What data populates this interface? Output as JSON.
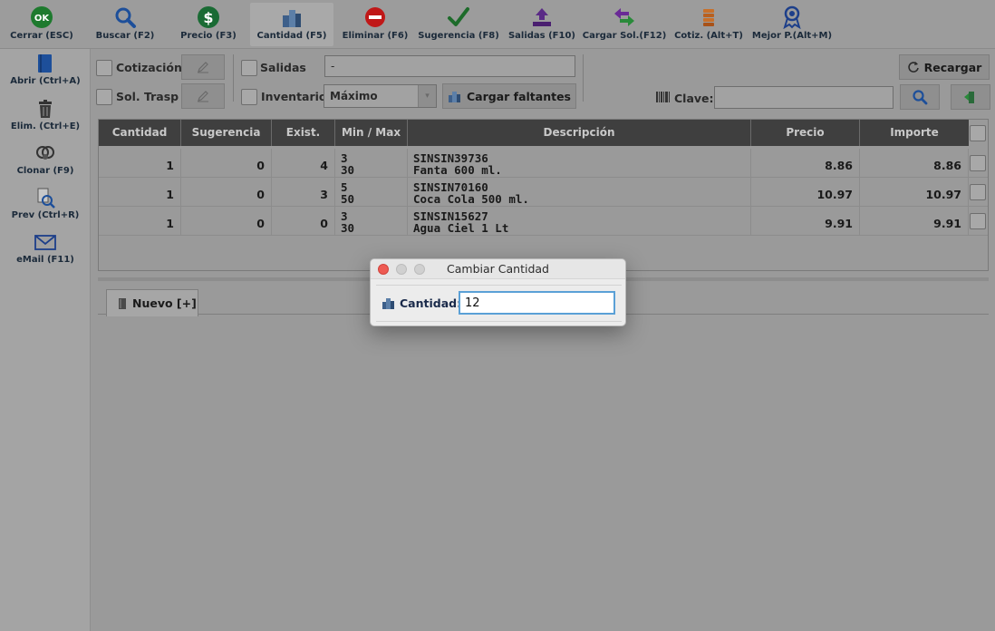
{
  "toolbar": {
    "buttons": [
      {
        "label": "Cerrar (ESC)",
        "icon": "ok-icon"
      },
      {
        "label": "Buscar (F2)",
        "icon": "search-icon"
      },
      {
        "label": "Precio (F3)",
        "icon": "dollar-icon"
      },
      {
        "label": "Cantidad (F5)",
        "icon": "cubes-icon"
      },
      {
        "label": "Eliminar (F6)",
        "icon": "no-entry-icon"
      },
      {
        "label": "Sugerencia (F8)",
        "icon": "checkmark-icon"
      },
      {
        "label": "Salidas (F10)",
        "icon": "upload-tray-icon"
      },
      {
        "label": "Cargar Sol.(F12)",
        "icon": "exchange-arrows-icon"
      },
      {
        "label": "Cotiz. (Alt+T)",
        "icon": "coins-stack-icon"
      },
      {
        "label": "Mejor P.(Alt+M)",
        "icon": "award-ribbon-icon"
      }
    ]
  },
  "sidebar": {
    "items": [
      {
        "label": "Abrir (Ctrl+A)",
        "icon": "open-book-icon"
      },
      {
        "label": "Elim. (Ctrl+E)",
        "icon": "trash-icon"
      },
      {
        "label": "Clonar (F9)",
        "icon": "clone-icon"
      },
      {
        "label": "Prev (Ctrl+R)",
        "icon": "preview-icon"
      },
      {
        "label": "eMail (F11)",
        "icon": "envelope-icon"
      }
    ]
  },
  "filters": {
    "cotizacion": "Cotización",
    "sol_trasp": "Sol. Trasp",
    "salidas": "Salidas",
    "salidas_value": "-",
    "inventario": "Inventario",
    "inventario_select": "Máximo",
    "cargar_faltantes": "Cargar faltantes",
    "recargar": "Recargar",
    "clave": "Clave:",
    "clave_value": ""
  },
  "table": {
    "headers": [
      "Cantidad",
      "Sugerencia",
      "Exist.",
      "Min / Max",
      "Descripción",
      "Precio",
      "Importe"
    ],
    "rows": [
      {
        "cantidad": "1",
        "sugerencia": "0",
        "exist": "4",
        "min": "3",
        "max": "30",
        "codigo": "SINSIN39736",
        "descripcion": "Fanta 600 ml.",
        "precio": "8.86",
        "importe": "8.86"
      },
      {
        "cantidad": "1",
        "sugerencia": "0",
        "exist": "3",
        "min": "5",
        "max": "50",
        "codigo": "SINSIN70160",
        "descripcion": "Coca Cola 500 ml.",
        "precio": "10.97",
        "importe": "10.97"
      },
      {
        "cantidad": "1",
        "sugerencia": "0",
        "exist": "0",
        "min": "3",
        "max": "30",
        "codigo": "SINSIN15627",
        "descripcion": "Agua Ciel 1 Lt",
        "precio": "9.91",
        "importe": "9.91"
      }
    ]
  },
  "tabs": {
    "nuevo": "Nuevo [+]"
  },
  "modal": {
    "title": "Cambiar Cantidad",
    "label": "Cantidad:",
    "value": "12"
  },
  "colors": {
    "toolbar_bg": "#9c9c9c",
    "header_bg": "#3f3f3f",
    "focus_ring": "#5aa0d6",
    "close_light": "#ee5a52"
  }
}
